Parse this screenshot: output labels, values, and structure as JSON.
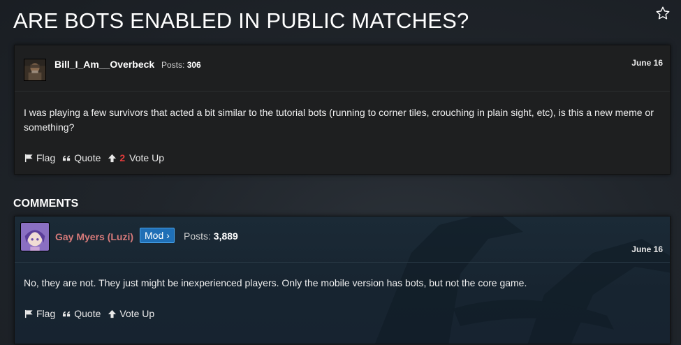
{
  "page": {
    "title": "ARE BOTS ENABLED IN PUBLIC MATCHES?",
    "favorite_icon": "star-outline-icon"
  },
  "post": {
    "username": "Bill_I_Am__Overbeck",
    "posts_label": "Posts:",
    "posts_count": "306",
    "date": "June 16",
    "body": "I was playing a few survivors that acted a bit similar to the tutorial bots (running to corner tiles, crouching in plain sight, etc), is this a new meme or something?",
    "actions": {
      "flag": "Flag",
      "quote": "Quote",
      "vote_count": "2",
      "vote_up": "Vote Up"
    }
  },
  "comments_section": {
    "title": "COMMENTS"
  },
  "comment": {
    "username": "Gay Myers (Luzi)",
    "badge": "Mod ›",
    "posts_label": "Posts:",
    "posts_count": "3,889",
    "date": "June 16",
    "body": "No, they are not. They just might be inexperienced players. Only the mobile version has bots, but not the core game.",
    "actions": {
      "flag": "Flag",
      "quote": "Quote",
      "vote_up": "Vote Up"
    }
  },
  "colors": {
    "background": "#20252b",
    "card": "#1e1f20",
    "comment_card": "#1b2a36",
    "mod_name": "#d77a7a",
    "mod_badge": "#1f6fb6",
    "vote_count": "#e23b3b"
  }
}
